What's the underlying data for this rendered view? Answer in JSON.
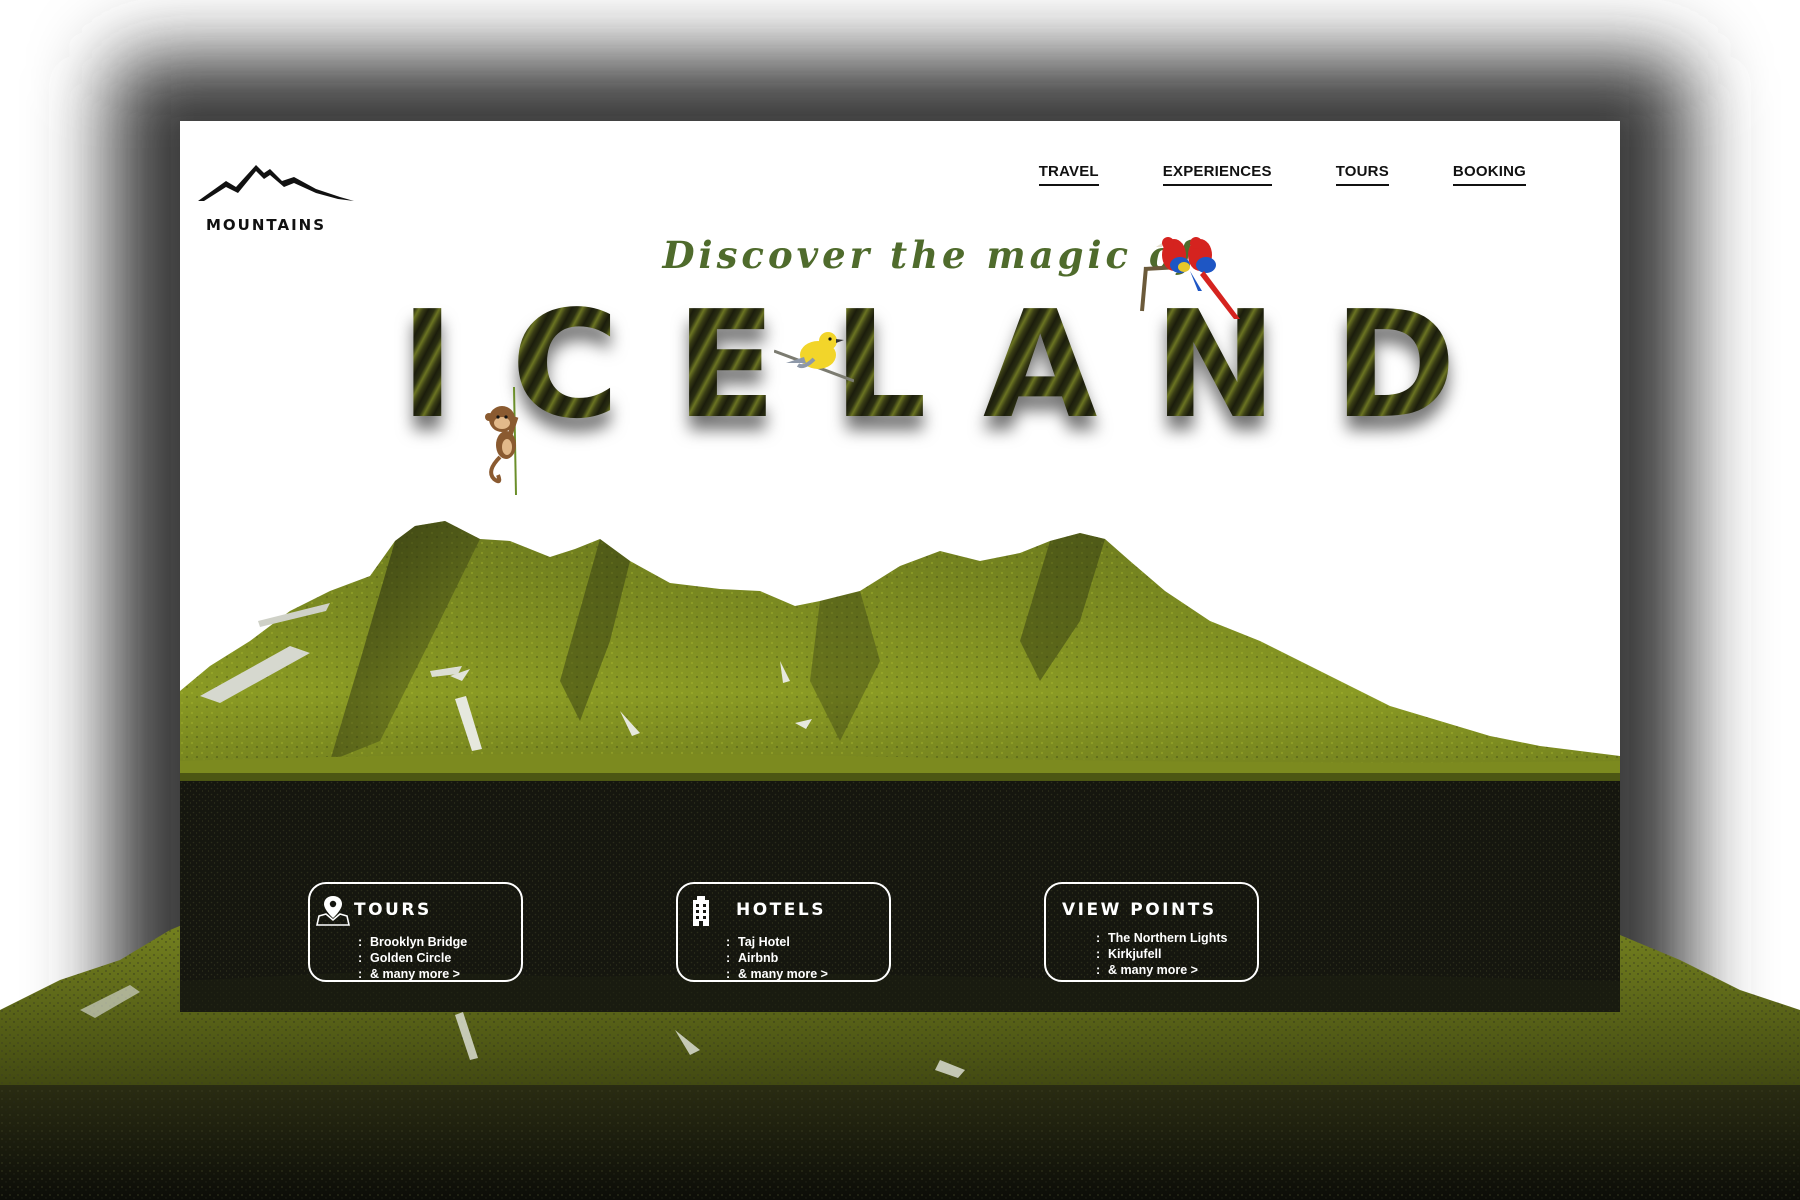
{
  "brand": {
    "name": "MOUNTAINS",
    "logo_icon": "mountain-peaks-icon"
  },
  "nav": {
    "items": [
      "TRAVEL",
      "EXPERIENCES",
      "TOURS",
      "BOOKING"
    ]
  },
  "hero": {
    "tagline": "Discover the magic of",
    "headline": "ICELAND"
  },
  "cards": [
    {
      "title": "TOURS",
      "icon": "map-pin-icon",
      "items": [
        "Brooklyn Bridge",
        "Golden Circle"
      ],
      "more": "& many more  >"
    },
    {
      "title": "HOTELS",
      "icon": "hotel-building-icon",
      "items": [
        "Taj Hotel",
        "Airbnb"
      ],
      "more": "& many more  >"
    },
    {
      "title": "VIEW POINTS",
      "icon": "",
      "items": [
        "The Northern Lights",
        "Kirkjufell"
      ],
      "more": "& many more  >"
    }
  ],
  "colors": {
    "tagline_green": "#4f6b2c",
    "moss_green": "#8a9a24",
    "ground_dark": "#141510",
    "backdrop_shadow": "#3a3a3a"
  }
}
